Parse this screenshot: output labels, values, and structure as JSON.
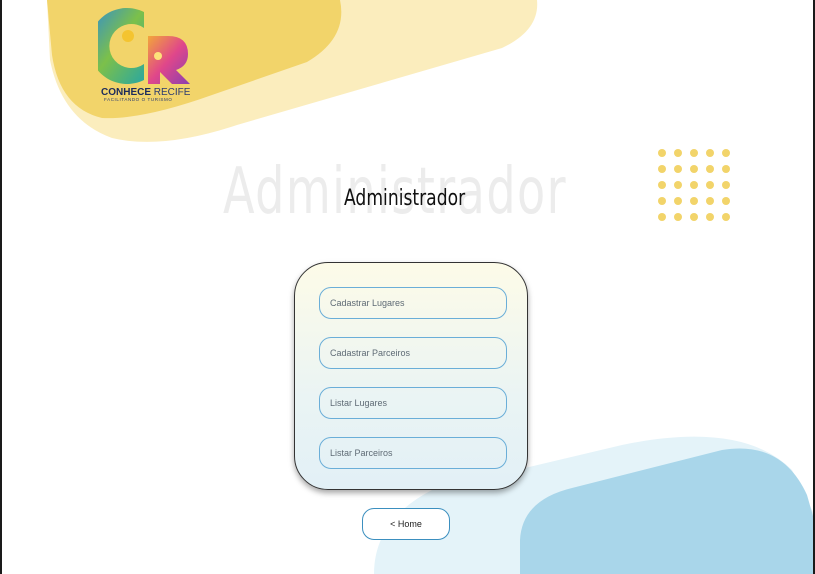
{
  "brand": {
    "name_bold": "CONHECE",
    "name_light": " RECIFE",
    "tagline": "FACILITANDO O TURISMO",
    "logo_letters": "CR"
  },
  "header": {
    "background_word": "Administrador",
    "title": "Administrador"
  },
  "menu": {
    "items": [
      {
        "label": "Cadastrar Lugares"
      },
      {
        "label": "Cadastrar Parceiros"
      },
      {
        "label": "Listar Lugares"
      },
      {
        "label": "Listar Parceiros"
      }
    ]
  },
  "footer": {
    "home_label": "< Home"
  },
  "colors": {
    "accent_yellow": "#f2d46a",
    "accent_yellow_light": "#fbedbd",
    "accent_blue": "#a9d6ea",
    "accent_blue_light": "#e4f3f9",
    "button_border": "#6aaed8"
  }
}
